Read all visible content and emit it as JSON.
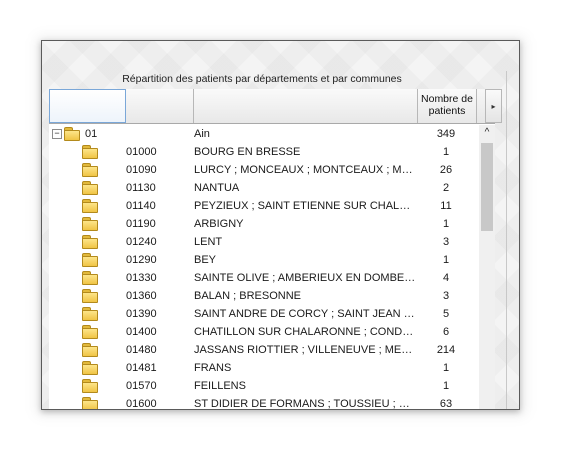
{
  "panel": {
    "title": "Répartition des patients par départements et par communes"
  },
  "header": {
    "count_label": "Nombre de patients",
    "scroll_right_glyph": "▸"
  },
  "scrollbar": {
    "up_glyph": "^"
  },
  "tree": {
    "department": {
      "code": "01",
      "name": "Ain",
      "count": "349",
      "toggle_glyph": "−"
    },
    "rows": [
      {
        "code": "01000",
        "name": "BOURG EN BRESSE",
        "count": "1"
      },
      {
        "code": "01090",
        "name": "LURCY ; MONCEAUX ; MONTCEAUX ; MON...",
        "count": "26"
      },
      {
        "code": "01130",
        "name": "NANTUA",
        "count": "2"
      },
      {
        "code": "01140",
        "name": "PEYZIEUX ; SAINT ETIENNE SUR CHALARO...",
        "count": "11"
      },
      {
        "code": "01190",
        "name": "ARBIGNY",
        "count": "1"
      },
      {
        "code": "01240",
        "name": "LENT",
        "count": "3"
      },
      {
        "code": "01290",
        "name": "BEY",
        "count": "1"
      },
      {
        "code": "01330",
        "name": "SAINTE OLIVE ; AMBERIEUX EN DOMBES ; ...",
        "count": "4"
      },
      {
        "code": "01360",
        "name": "BALAN ; BRESONNE",
        "count": "3"
      },
      {
        "code": "01390",
        "name": "SAINT ANDRE DE CORCY ; SAINT JEAN DE...",
        "count": "5"
      },
      {
        "code": "01400",
        "name": "CHATILLON SUR CHALARONNE ; CONDESS...",
        "count": "6"
      },
      {
        "code": "01480",
        "name": "JASSANS RIOTTIER ; VILLENEUVE ; MESSI...",
        "count": "214"
      },
      {
        "code": "01481",
        "name": "FRANS",
        "count": "1"
      },
      {
        "code": "01570",
        "name": "FEILLENS",
        "count": "1"
      },
      {
        "code": "01600",
        "name": "ST DIDIER DE FORMANS ; TOUSSIEU ; ST ...",
        "count": "63"
      }
    ]
  }
}
